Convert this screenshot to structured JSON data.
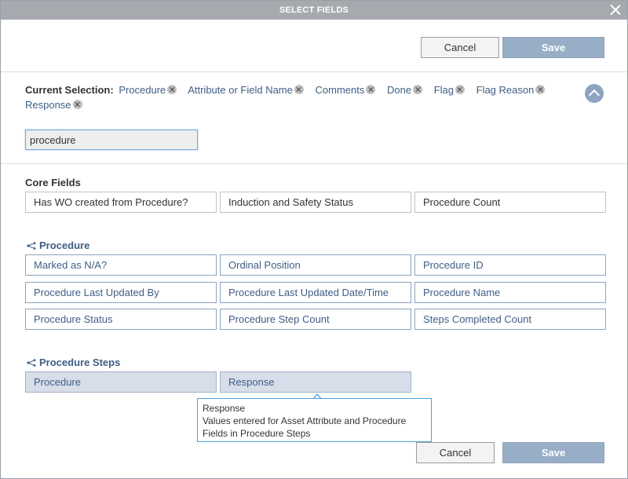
{
  "dialog": {
    "title": "SELECT FIELDS",
    "close_icon": "close-icon"
  },
  "top_buttons": {
    "cancel_label": "Cancel",
    "save_label": "Save"
  },
  "bottom_buttons": {
    "cancel_label": "Cancel",
    "save_label": "Save"
  },
  "current_selection": {
    "label": "Current Selection:",
    "chips": [
      "Procedure",
      "Attribute or Field Name",
      "Comments",
      "Done",
      "Flag",
      "Flag Reason",
      "Response"
    ]
  },
  "search": {
    "value": "procedure"
  },
  "core_fields": {
    "title": "Core Fields",
    "items": [
      "Has WO created from Procedure?",
      "Induction and Safety Status",
      "Procedure Count"
    ]
  },
  "procedure": {
    "title": "Procedure",
    "items": [
      "Marked as N/A?",
      "Ordinal Position",
      "Procedure ID",
      "Procedure Last Updated By",
      "Procedure Last Updated Date/Time",
      "Procedure Name",
      "Procedure Status",
      "Procedure Step Count",
      "Steps Completed Count"
    ]
  },
  "procedure_steps": {
    "title": "Procedure Steps",
    "items": [
      "Procedure",
      "Response"
    ]
  },
  "tooltip": {
    "title": "Response",
    "description": "Values entered for Asset Attribute and Procedure Fields in Procedure Steps"
  },
  "colors": {
    "titlebar": "#a6a9ad",
    "save_button": "#98adc6",
    "link_blue": "#3f5e86",
    "selected_field": "#d7dde9",
    "tooltip_border": "#4aa3df"
  }
}
